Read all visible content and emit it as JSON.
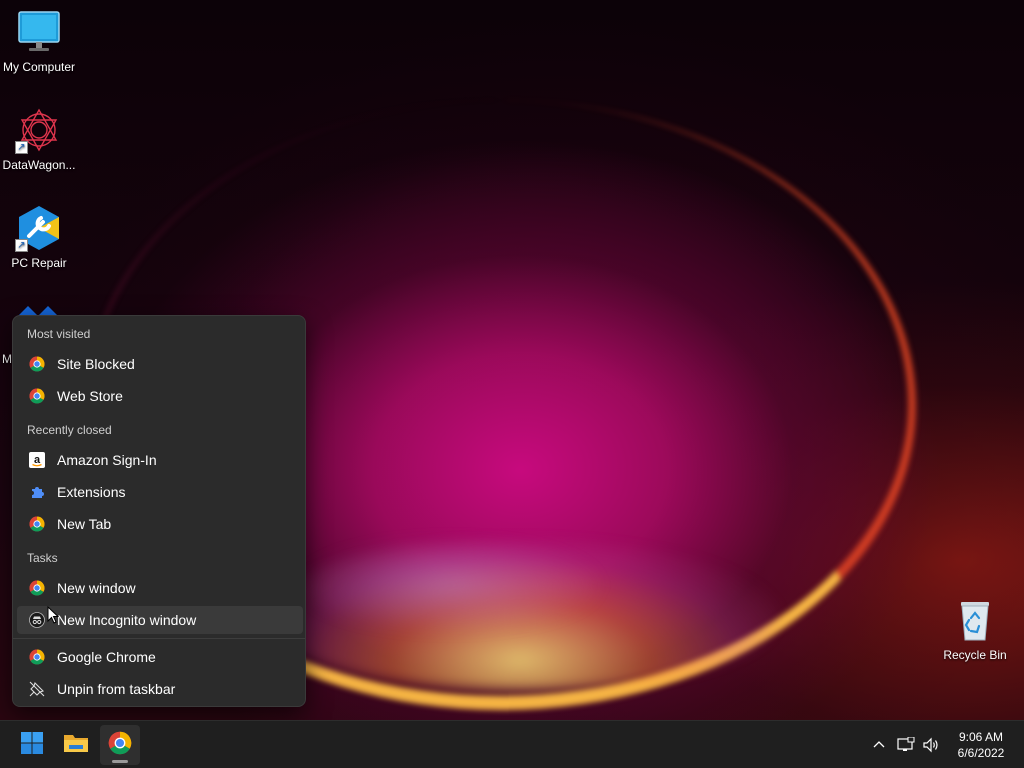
{
  "desktop": {
    "icons": [
      {
        "label": "My Computer",
        "icon": "monitor-icon"
      },
      {
        "label": "DataWagon...",
        "icon": "datawagon-icon"
      },
      {
        "label": "PC Repair",
        "icon": "pc-repair-icon"
      },
      {
        "label": "M",
        "icon": "partial-app-icon"
      },
      {
        "label": "Recycle Bin",
        "icon": "recycle-bin-icon"
      }
    ]
  },
  "jumplist": {
    "most_visited_header": "Most visited",
    "most_visited": [
      {
        "label": "Site Blocked",
        "icon": "chrome-icon"
      },
      {
        "label": "Web Store",
        "icon": "chrome-icon"
      }
    ],
    "recently_closed_header": "Recently closed",
    "recently_closed": [
      {
        "label": "Amazon Sign-In",
        "icon": "amazon-icon"
      },
      {
        "label": "Extensions",
        "icon": "puzzle-piece-icon"
      },
      {
        "label": "New Tab",
        "icon": "chrome-icon"
      }
    ],
    "tasks_header": "Tasks",
    "tasks": [
      {
        "label": "New window",
        "icon": "chrome-icon"
      },
      {
        "label": "New Incognito window",
        "icon": "incognito-icon"
      }
    ],
    "pinned": [
      {
        "label": "Google Chrome",
        "icon": "chrome-icon"
      },
      {
        "label": "Unpin from taskbar",
        "icon": "unpin-icon"
      }
    ]
  },
  "taskbar": {
    "apps": [
      {
        "name": "Start",
        "icon": "windows-start-icon"
      },
      {
        "name": "File Explorer",
        "icon": "folder-icon"
      },
      {
        "name": "Google Chrome",
        "icon": "chrome-icon"
      }
    ],
    "tray": {
      "icons": [
        "chevron-up-icon",
        "network-icon",
        "volume-icon"
      ],
      "time": "9:06 AM",
      "date": "6/6/2022"
    }
  },
  "colors": {
    "menu_bg": "#2b2b2b",
    "taskbar_bg": "#1f1f1f",
    "chrome_red": "#db4437",
    "chrome_yellow": "#f4b400",
    "chrome_green": "#0f9d58",
    "chrome_blue": "#4285f4",
    "start_blue": "#0078d4"
  }
}
